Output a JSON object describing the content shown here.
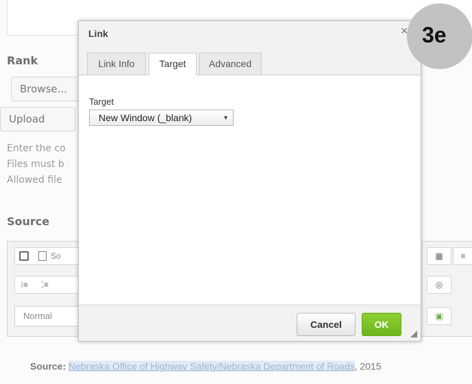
{
  "background": {
    "rank_title": "Rank",
    "browse_label": "Browse...",
    "upload_label": "Upload",
    "help_lines": [
      "Enter the co",
      "Files must b",
      "Allowed file"
    ],
    "source_title": "Source",
    "toolbar": {
      "save_icon": "save-icon",
      "source_label": "So",
      "format_combo": "Normal"
    },
    "credit": {
      "label": "Source:",
      "link_text": "Nebraska Office of Highway Safety/Nebraska Department of Roads",
      "year": ", 2015"
    }
  },
  "dialog": {
    "title": "Link",
    "close_glyph": "×",
    "tabs": [
      {
        "label": "Link Info",
        "active": false
      },
      {
        "label": "Target",
        "active": true
      },
      {
        "label": "Advanced",
        "active": false
      }
    ],
    "target_label": "Target",
    "target_select": {
      "value": "New Window (_blank)"
    },
    "cancel_label": "Cancel",
    "ok_label": "OK"
  },
  "badge": {
    "text": "3e"
  },
  "colors": {
    "ok_green": "#7cc228",
    "link_blue": "#9db6d3",
    "badge_gray": "#c2c2c2"
  }
}
